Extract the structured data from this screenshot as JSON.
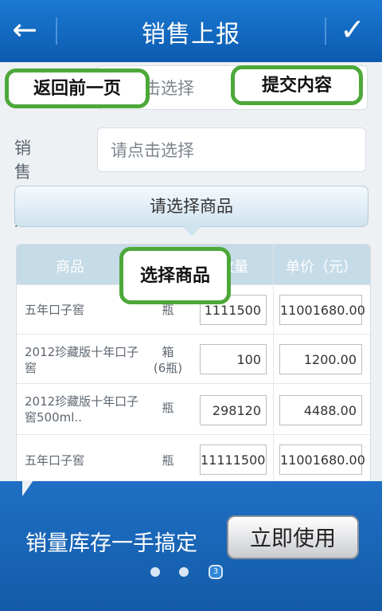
{
  "header": {
    "title": "销售上报",
    "back_icon": "arrow-left-icon",
    "submit_icon": "checkmark-icon"
  },
  "form": {
    "first_field_placeholder": "请点击选择",
    "date_label": "销售日期",
    "date_placeholder": "请点击选择",
    "select_product_label": "请选择商品"
  },
  "table": {
    "columns": [
      "商品",
      "单位",
      "数量",
      "单价（元）"
    ],
    "rows": [
      {
        "name": "五年口子窖",
        "unit": "瓶",
        "qty": "1111500",
        "price": "11001680.00"
      },
      {
        "name": "2012珍藏版十年口子窖",
        "unit": "箱\n(6瓶)",
        "qty": "100",
        "price": "1200.00"
      },
      {
        "name": "2012珍藏版十年口子窖500ml..",
        "unit": "瓶",
        "qty": "298120",
        "price": "4488.00"
      },
      {
        "name": "五年口子窖",
        "unit": "瓶",
        "qty": "11111500",
        "price": "11001680.00"
      }
    ]
  },
  "callouts": {
    "back": "返回前一页",
    "submit": "提交内容",
    "product": "选择商品"
  },
  "banner": {
    "slogan": "销量库存一手搞定",
    "use_button": "立即使用",
    "page_indicator": "3"
  },
  "colors": {
    "header_blue": "#1b79d2",
    "callout_green": "#4da83a",
    "banner_blue": "#1f6fc4"
  }
}
